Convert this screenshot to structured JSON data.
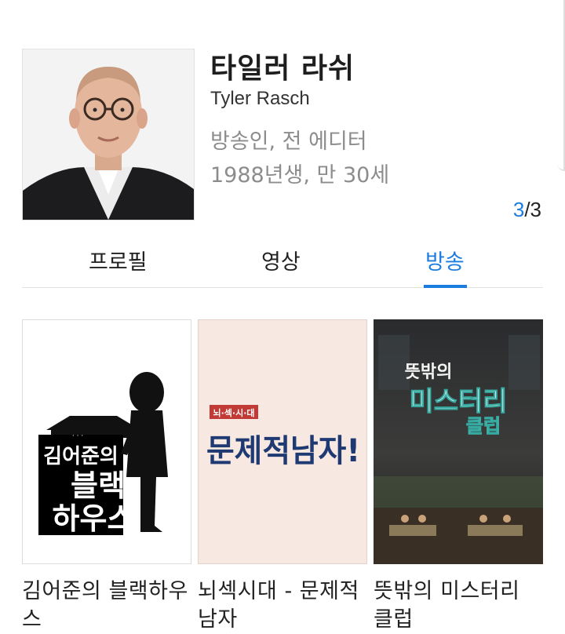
{
  "profile": {
    "name_ko": "타일러 라쉬",
    "name_en": "Tyler Rasch",
    "occupation": "방송인, 전 에디터",
    "birth": "1988년생, 만 30세"
  },
  "pager": {
    "current": "3",
    "total": "/3"
  },
  "tabs": [
    {
      "label": "프로필"
    },
    {
      "label": "영상"
    },
    {
      "label": "방송",
      "active": true
    }
  ],
  "programs": [
    {
      "title": "김어준의 블랙하우스",
      "poster": {
        "line1": "김어준의",
        "line2": "블랙",
        "line3": "하우스"
      }
    },
    {
      "title": "뇌섹시대 - 문제적 남자",
      "poster": {
        "tag": "뇌·섹·시·대",
        "main": "문제적남자!"
      }
    },
    {
      "title": "뜻밖의 미스터리 클럽",
      "poster": {
        "line1": "뜻밖의",
        "line2": "미스터리",
        "line3": "클럽"
      }
    }
  ],
  "colors": {
    "accent": "#1b7ce0",
    "secondary_text": "#8c8c8c"
  }
}
